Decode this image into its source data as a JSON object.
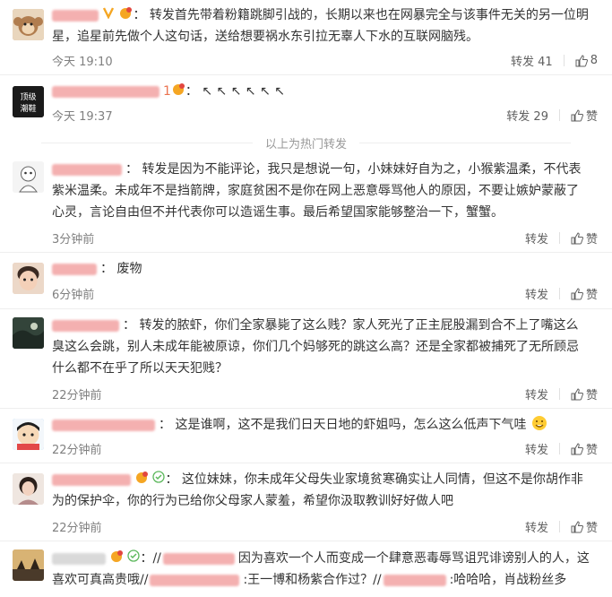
{
  "comments": [
    {
      "text": "转发首先带着粉籍跳脚引战的，长期以来也在网暴完全与该事件无关的另一位明星，追星前先做个人这句话，送给想要祸水东引拉无辜人下水的互联网脑残。",
      "time": "今天 19:10",
      "repost_label": "转发 41",
      "like_count": "8"
    },
    {
      "name_suffix": "1",
      "text": "↖ ↖ ↖ ↖ ↖ ↖",
      "time": "今天 19:37",
      "repost_label": "转发 29",
      "like_label": "赞"
    },
    {
      "text": "转发是因为不能评论，我只是想说一句，小妹妹好自为之，小猴紫温柔，不代表紫米温柔。未成年不是挡箭牌，家庭贫困不是你在网上恶意辱骂他人的原因，不要让嫉妒蒙蔽了心灵，言论自由但不并代表你可以造谣生事。最后希望国家能够整治一下，蟹蟹。",
      "time": "3分钟前",
      "repost_label": "转发",
      "like_label": "赞"
    },
    {
      "text": "废物",
      "time": "6分钟前",
      "repost_label": "转发",
      "like_label": "赞"
    },
    {
      "text": "转发的脓虾，你们全家暴毙了这么贱？家人死光了正主屁股漏到合不上了嘴这么臭这么会跳，别人未成年能被原谅，你们几个妈够死的跳这么高？还是全家都被捕死了无所顾忌什么都不在乎了所以天天犯贱？",
      "time": "22分钟前",
      "repost_label": "转发",
      "like_label": "赞"
    },
    {
      "text": "这是谁啊，这不是我们日天日地的虾姐吗，怎么这么低声下气哇",
      "time": "22分钟前",
      "repost_label": "转发",
      "like_label": "赞"
    },
    {
      "text": "这位妹妹，你未成年父母失业家境贫寒确实让人同情，但这不是你胡作非为的保护伞，你的行为已给你父母家人蒙羞，希望你汲取教训好好做人吧",
      "time": "22分钟前",
      "repost_label": "转发",
      "like_label": "赞"
    },
    {
      "text_a": "因为喜欢一个人而变成一个肆意恶毒辱骂诅咒诽谤别人的人，这",
      "text_b": "喜欢可真高贵哦//",
      "text_c": ":王一博和杨紫合作过？//",
      "text_d": ":哈哈哈，肖战粉丝多"
    }
  ],
  "divider_label": "以上为热门转发",
  "colors": {
    "link": "#eb7350",
    "meta": "#808080",
    "text": "#333333"
  }
}
